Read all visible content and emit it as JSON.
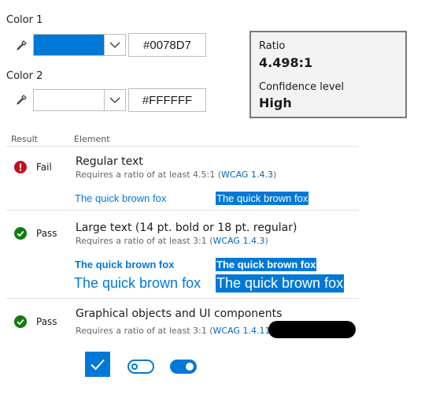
{
  "color1": {
    "label": "Color 1",
    "swatch": "#0078D7",
    "hex": "#0078D7"
  },
  "color2": {
    "label": "Color 2",
    "swatch": "#FFFFFF",
    "hex": "#FFFFFF"
  },
  "ratio": {
    "ratio_label": "Ratio",
    "ratio_value": "4.498:1",
    "confidence_label": "Confidence level",
    "confidence_value": "High"
  },
  "table": {
    "col_result": "Result",
    "col_element": "Element",
    "rows": [
      {
        "status": "Fail",
        "status_icon": "error-icon",
        "status_color": "#c50f1f",
        "title": "Regular text",
        "requirement": "Requires a ratio of at least 4.5:1 (",
        "link": "WCAG 1.4.3",
        "requirement_end": ")",
        "sample_fg": "The quick brown fox",
        "sample_bg": "The quick brown fox"
      },
      {
        "status": "Pass",
        "status_icon": "check-circle-icon",
        "status_color": "#107c10",
        "title": "Large text (14 pt. bold or 18 pt. regular)",
        "requirement": "Requires a ratio of at least 3:1 (",
        "link": "WCAG 1.4.3",
        "requirement_end": ")",
        "sample_bold_fg": "The quick brown fox",
        "sample_bold_bg": "The quick brown fox",
        "sample_large_fg": "The quick brown fox",
        "sample_large_bg": "The quick brown fox"
      },
      {
        "status": "Pass",
        "status_icon": "check-circle-icon",
        "status_color": "#107c10",
        "title": "Graphical objects and UI components",
        "requirement": "Requires a ratio of at least 3:1 (",
        "link": "WCAG 1.4.11",
        "requirement_end": ")"
      }
    ]
  },
  "accent": "#0078D7"
}
